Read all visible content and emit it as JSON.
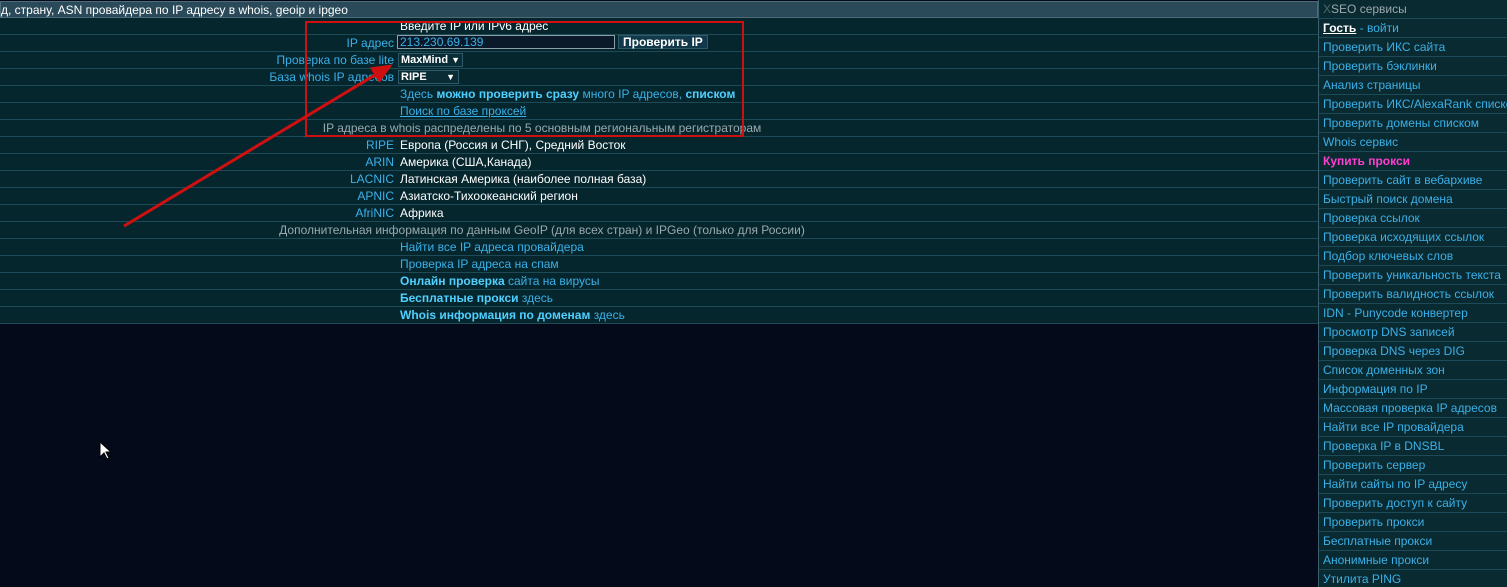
{
  "header": {
    "title": "д, страну, ASN провайдера по IP адресу в whois, geoip и ipgeo"
  },
  "form": {
    "prompt": "Введите IP или IPv6 адрес",
    "ip_label": "IP адрес",
    "ip_value": "213.230.69.139",
    "check_button": "Проверить IP",
    "lite_label": "Проверка по базе lite",
    "lite_select": "MaxMind",
    "whois_label": "База whois IP адресов",
    "whois_select": "RIPE",
    "bulk_line": {
      "part1": "Здесь",
      "part2": "можно проверить сразу",
      "part3": "много IP адресов,",
      "part4": "списком"
    },
    "proxy_search": "Поиск по базе проксей",
    "registry_note": "IP адреса в whois распределены по 5 основным региональным регистраторам"
  },
  "registries": [
    {
      "name": "RIPE",
      "region": "Европа (Россия и СНГ), Средний Восток"
    },
    {
      "name": "ARIN",
      "region": "Америка (США,Канада)"
    },
    {
      "name": "LACNIC",
      "region": "Латинская Америка (наиболее полная база)"
    },
    {
      "name": "APNIC",
      "region": "Азиатско-Тихоокеанский регион"
    },
    {
      "name": "AfriNIC",
      "region": "Африка"
    }
  ],
  "extra": {
    "geo_note": "Дополнительная информация по данным GeoIP (для всех стран) и IPGeo (только для России)",
    "find_all": "Найти все IP адреса провайдера",
    "spam_check": "Проверка IP адреса на спам",
    "virus_a": "Онлайн проверка",
    "virus_b": "сайта на вирусы",
    "free_proxy_a": "Бесплатные прокси",
    "free_proxy_b": "здесь",
    "whois_domains_a": "Whois информация по доменам",
    "whois_domains_b": "здесь"
  },
  "sidebar": {
    "title_x": "X",
    "title_rest": "SEO сервисы",
    "guest": "Гость",
    "login": " - войти",
    "items": [
      "Проверить ИКС сайта",
      "Проверить бэклинки",
      "Анализ страницы",
      "Проверить ИКС/AlexaRank списком",
      "Проверить домены списком",
      "Whois сервис",
      "Купить прокси",
      "Проверить сайт в вебархиве",
      "Быстрый поиск домена",
      "Проверка ссылок",
      "Проверка исходящих ссылок",
      "Подбор ключевых слов",
      "Проверить уникальность текста",
      "Проверить валидность ссылок",
      "IDN - Punycode конвертер",
      "Просмотр DNS записей",
      "Проверка DNS через DIG",
      "Список доменных зон",
      "Информация по IP",
      "Массовая проверка IP адресов",
      "Найти все IP провайдера",
      "Проверка IP в DNSBL",
      "Проверить сервер",
      "Найти сайты по IP адресу",
      "Проверить доступ к сайту",
      "Проверить прокси",
      "Бесплатные прокси",
      "Анонимные прокси",
      "Утилита PING"
    ]
  },
  "colors": {
    "background": "#050a1a",
    "link": "#3ab0e8",
    "highlight": "#ff3fd0",
    "annotation": "#d01010"
  }
}
